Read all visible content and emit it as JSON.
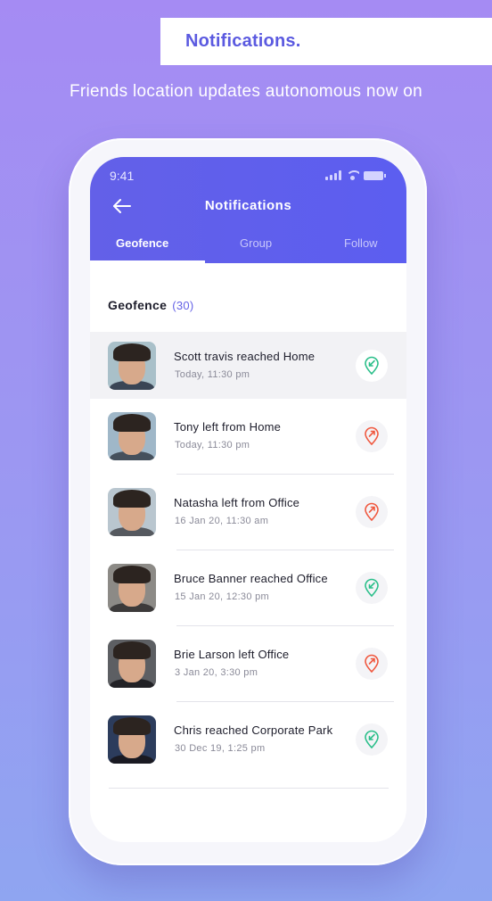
{
  "banner": {
    "title": "Notifications."
  },
  "subtitle": "Friends location updates autonomous now on",
  "phone": {
    "status_bar": {
      "time": "9:41"
    },
    "appbar": {
      "title": "Notifications"
    },
    "tabs": [
      {
        "label": "Geofence",
        "active": true
      },
      {
        "label": "Group",
        "active": false
      },
      {
        "label": "Follow",
        "active": false
      }
    ],
    "section": {
      "label": "Geofence",
      "count": "(30)"
    },
    "notifications": [
      {
        "title": "Scott travis reached Home",
        "time": "Today, 11:30 pm",
        "type": "reached",
        "icon": "pin-arrow-in-icon"
      },
      {
        "title": "Tony left from Home",
        "time": "Today, 11:30 pm",
        "type": "left",
        "icon": "pin-arrow-out-icon"
      },
      {
        "title": "Natasha left from Office",
        "time": "16 Jan 20, 11:30 am",
        "type": "left",
        "icon": "pin-arrow-out-icon"
      },
      {
        "title": "Bruce Banner reached Office",
        "time": "15 Jan 20, 12:30 pm",
        "type": "reached",
        "icon": "pin-arrow-in-icon"
      },
      {
        "title": "Brie Larson left Office",
        "time": "3 Jan 20, 3:30 pm",
        "type": "left",
        "icon": "pin-arrow-out-icon"
      },
      {
        "title": "Chris reached Corporate Park",
        "time": "30 Dec 19, 1:25 pm",
        "type": "reached",
        "icon": "pin-arrow-in-icon"
      }
    ]
  },
  "colors": {
    "accent": "#5c5ef0",
    "reached": "#2bbf8a",
    "left": "#f0583f"
  }
}
